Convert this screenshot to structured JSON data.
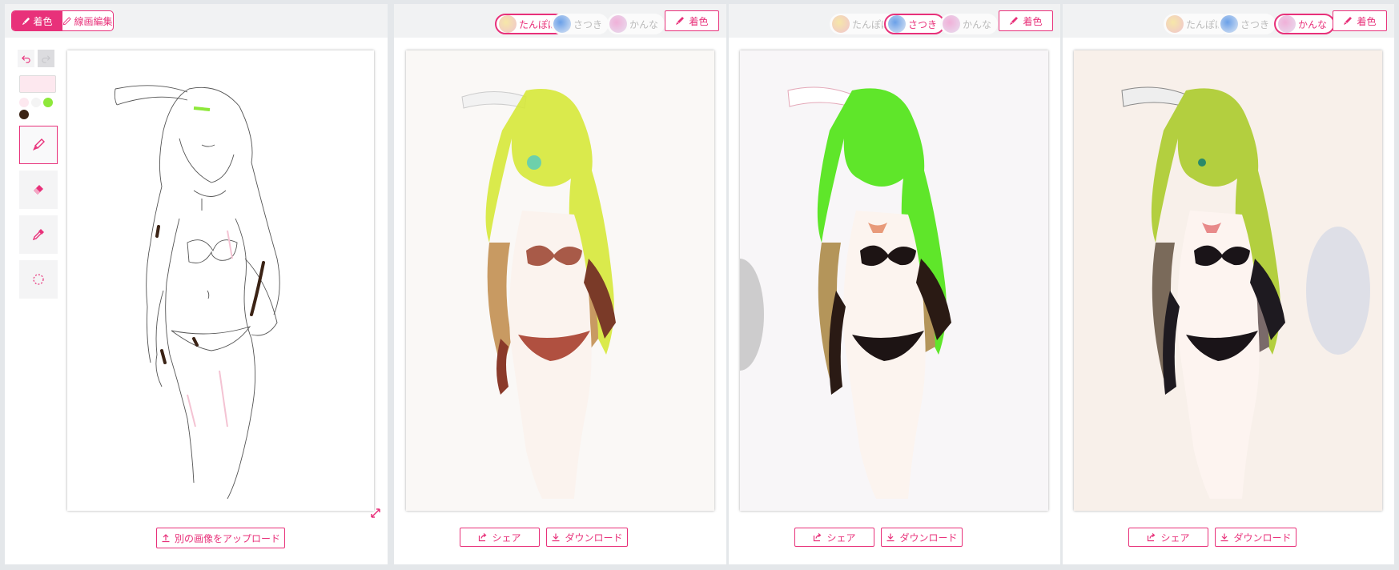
{
  "editor": {
    "mode_tabs": [
      {
        "label": "着色",
        "active": true
      },
      {
        "label": "線画編集",
        "active": false
      }
    ],
    "undo_icon": "undo-icon",
    "redo_icon": "redo-icon",
    "current_color": "#fde8ef",
    "palette": [
      "#fde8ef",
      "#f4f4f4",
      "#8ee83a",
      "#3b2315"
    ],
    "tools": [
      {
        "name": "brush",
        "icon": "brush-icon",
        "active": true
      },
      {
        "name": "eraser",
        "icon": "eraser-icon",
        "active": false
      },
      {
        "name": "eyedropper",
        "icon": "eyedropper-icon",
        "active": false
      },
      {
        "name": "lasso",
        "icon": "lasso-icon",
        "active": false
      }
    ],
    "upload_label": "別の画像をアップロード"
  },
  "style_options": [
    "たんぽぽ",
    "さつき",
    "かんな"
  ],
  "results": [
    {
      "selected_style": 0,
      "colorize_label": "着色",
      "share_label": "シェア",
      "download_label": "ダウンロード",
      "hair_color": "#d6e83a"
    },
    {
      "selected_style": 1,
      "colorize_label": "着色",
      "share_label": "シェア",
      "download_label": "ダウンロード",
      "hair_color": "#5fe62a"
    },
    {
      "selected_style": 2,
      "colorize_label": "着色",
      "share_label": "シェア",
      "download_label": "ダウンロード",
      "hair_color": "#b3cf3f"
    }
  ],
  "colors": {
    "accent": "#e8317a",
    "background": "#e4e7ea",
    "header": "#f1f2f3"
  }
}
